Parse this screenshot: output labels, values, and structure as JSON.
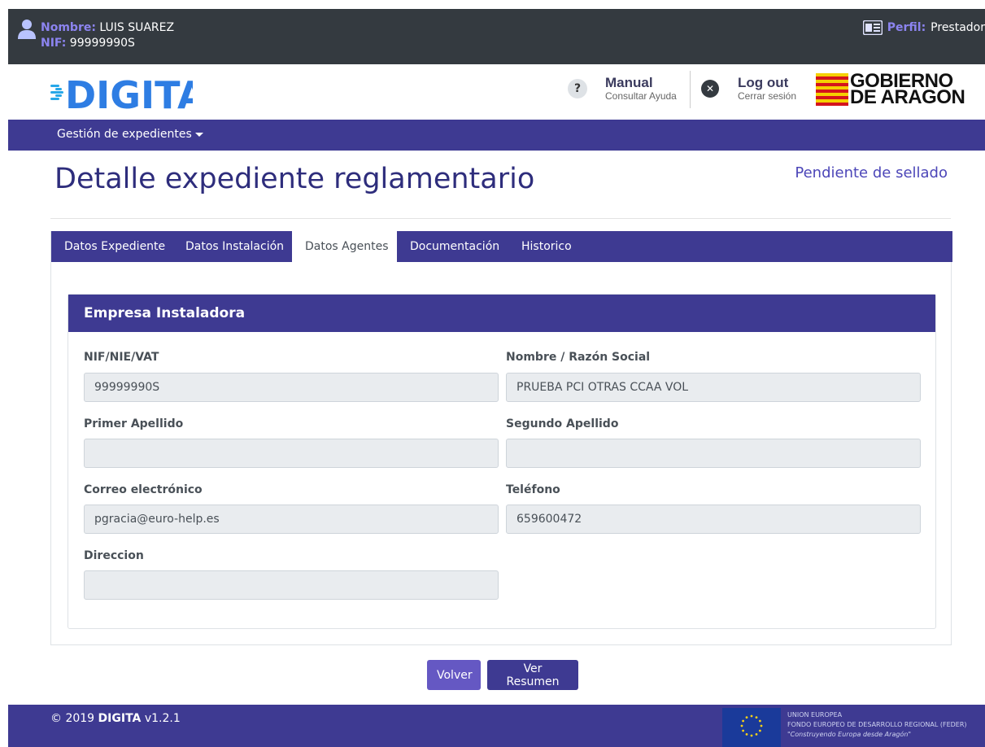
{
  "topbar": {
    "nombre_label": "Nombre:",
    "nombre_value": "LUIS SUAREZ",
    "nif_label": "NIF:",
    "nif_value": "99999990S",
    "perfil_label": "Perfil:",
    "perfil_value": "Prestador"
  },
  "header": {
    "logo_text": "DIGITA",
    "help_icon": "?",
    "manual_title": "Manual",
    "manual_sub": "Consultar Ayuda",
    "logout_title": "Log out",
    "logout_sub": "Cerrar sesión",
    "gobierno_line1": "GOBIERNO",
    "gobierno_line2": "DE ARAGON"
  },
  "nav": {
    "menu_label": "Gestión de expedientes"
  },
  "page": {
    "title": "Detalle expediente reglamentario",
    "status": "Pendiente de sellado"
  },
  "tabs": [
    {
      "label": "Datos Expediente",
      "active": false
    },
    {
      "label": "Datos Instalación",
      "active": false
    },
    {
      "label": "Datos Agentes",
      "active": true
    },
    {
      "label": "Documentación",
      "active": false
    },
    {
      "label": "Historico",
      "active": false
    }
  ],
  "empresa": {
    "title": "Empresa Instaladora",
    "fields": {
      "nif": {
        "label": "NIF/NIE/VAT",
        "value": "99999990S"
      },
      "nombre": {
        "label": "Nombre / Razón Social",
        "value": "PRUEBA PCI OTRAS CCAA VOL"
      },
      "apellido1": {
        "label": "Primer Apellido",
        "value": ""
      },
      "apellido2": {
        "label": "Segundo Apellido",
        "value": ""
      },
      "email": {
        "label": "Correo electrónico",
        "value": "pgracia@euro-help.es"
      },
      "telefono": {
        "label": "Teléfono",
        "value": "659600472"
      },
      "direccion": {
        "label": "Direccion",
        "value": ""
      }
    }
  },
  "buttons": {
    "volver": "Volver",
    "resumen": "Ver Resumen"
  },
  "footer": {
    "copyright": "© 2019",
    "brand": "DIGITA",
    "version": "v1.2.1",
    "eu_line1": "UNION EUROPEA",
    "eu_line2": "FONDO EUROPEO DE DESARROLLO REGIONAL (FEDER)",
    "eu_line3": "\"Construyendo Europa desde Aragón\""
  },
  "icons": {
    "user": "user-icon",
    "perfil": "id-card-icon",
    "help": "question-circle-icon",
    "logout": "close-circle-icon",
    "caret": "caret-down-icon"
  },
  "colors": {
    "primary": "#3e3a92",
    "accent": "#8c84f0",
    "topbar": "#343a40",
    "volver": "#6558c3"
  }
}
